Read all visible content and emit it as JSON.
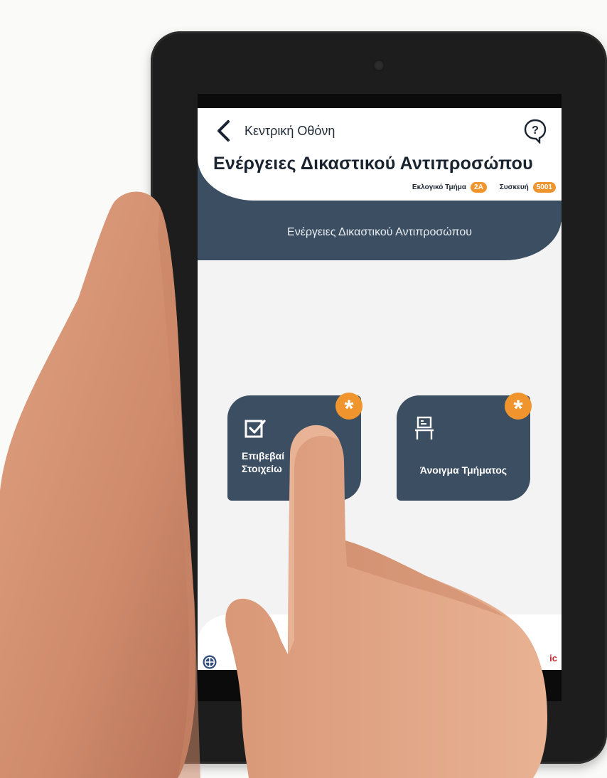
{
  "nav": {
    "back_label": "Κεντρική Οθόνη"
  },
  "header": {
    "title": "Ενέργειες Δικαστικού Αντιπροσώπου",
    "section_label": "Εκλογικό Τμήμα",
    "section_value": "2A",
    "device_label": "Συσκευή",
    "device_value": "5001"
  },
  "main": {
    "heading": "Ενέργειες Δικαστικού Αντιπροσώπου",
    "tiles": [
      {
        "label": "Επιβεβαί\nΣτοιχείω",
        "icon": "checkbox-icon",
        "badge": "*"
      },
      {
        "label": "Άνοιγμα Τμήματος",
        "icon": "desk-board-icon",
        "badge": "*"
      }
    ]
  },
  "footer": {
    "brand": "ic"
  },
  "colors": {
    "primary": "#3c4e62",
    "accent": "#f0952e",
    "background": "#f3f3f3"
  }
}
